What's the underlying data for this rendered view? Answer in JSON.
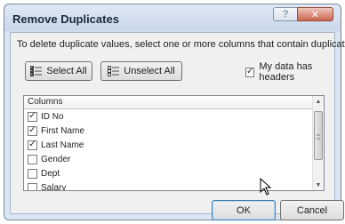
{
  "dialog": {
    "title": "Remove Duplicates",
    "help_icon": "question-icon",
    "close_icon": "close-icon"
  },
  "description": "To delete duplicate values, select one or more columns that contain duplicates.",
  "buttons": {
    "select_all": "Select All",
    "unselect_all": "Unselect All",
    "ok": "OK",
    "cancel": "Cancel"
  },
  "has_headers": {
    "label": "My data has headers",
    "checked": true
  },
  "columns": {
    "header": "Columns",
    "items": [
      {
        "label": "ID No",
        "checked": true
      },
      {
        "label": "First Name",
        "checked": true
      },
      {
        "label": "Last Name",
        "checked": true
      },
      {
        "label": "Gender",
        "checked": false
      },
      {
        "label": "Dept",
        "checked": false
      },
      {
        "label": "Salary",
        "checked": false
      }
    ]
  },
  "icons": {
    "select_all": "select-all-list-icon",
    "unselect_all": "unselect-all-list-icon",
    "cursor": "mouse-pointer-icon"
  }
}
